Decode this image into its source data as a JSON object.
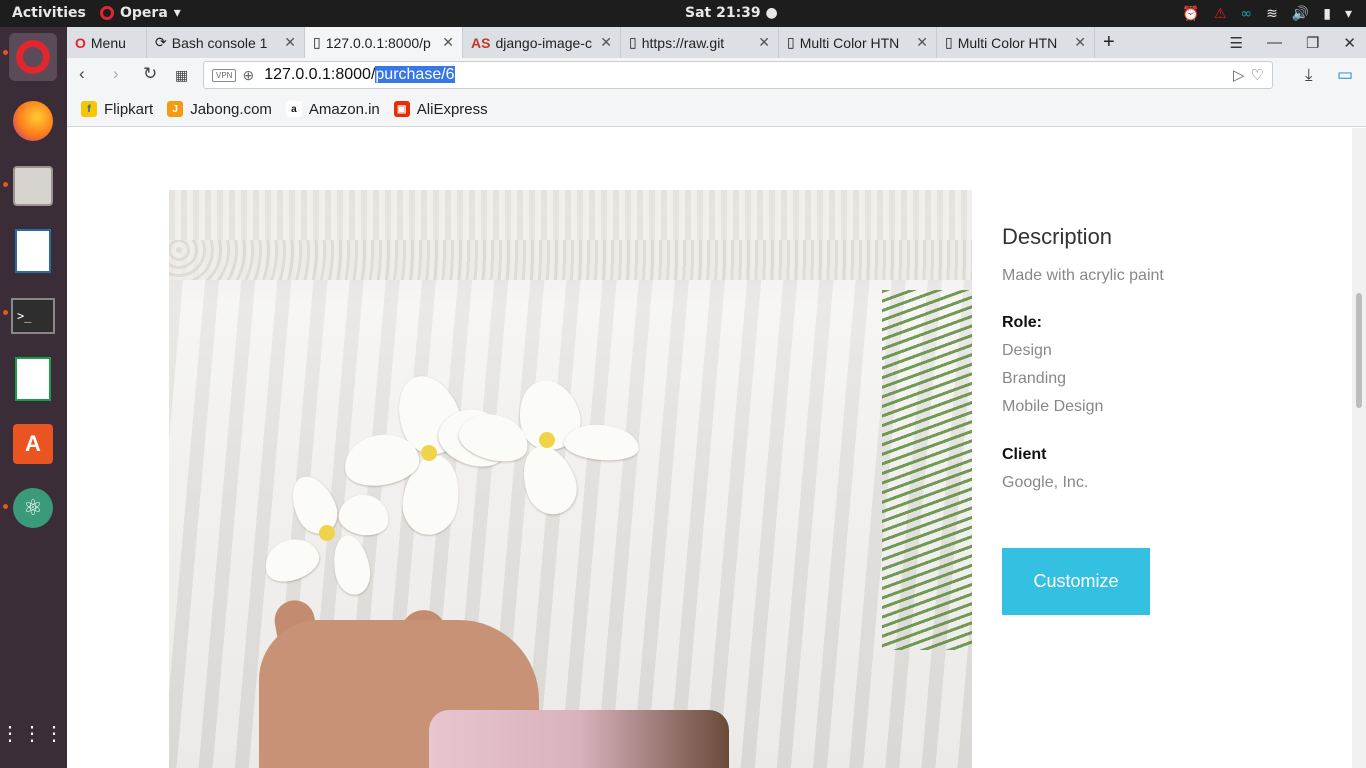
{
  "topbar": {
    "activities": "Activities",
    "app_name": "Opera",
    "clock": "Sat 21:39 ●"
  },
  "dock": {
    "icons": [
      "opera-browser",
      "firefox",
      "file-manager",
      "libreoffice-writer",
      "terminal",
      "libreoffice-calc",
      "software-center",
      "atom-editor",
      "show-applications"
    ]
  },
  "browser": {
    "menu_label": "Menu",
    "tabs": [
      {
        "label": "Bash console 1"
      },
      {
        "label": "127.0.0.1:8000/p"
      },
      {
        "label": "django-image-c"
      },
      {
        "label": "https://raw.git"
      },
      {
        "label": "Multi Color HTN"
      },
      {
        "label": "Multi Color HTN"
      }
    ],
    "vpn_label": "VPN",
    "url_base": "127.0.0.1:8000/",
    "url_selected": "purchase/6",
    "bookmarks": [
      {
        "label": "Flipkart",
        "color": "#f7c600"
      },
      {
        "label": "Jabong.com",
        "color": "#f39c12"
      },
      {
        "label": "Amazon.in",
        "color": "#ffffff"
      },
      {
        "label": "AliExpress",
        "color": "#e62e04"
      }
    ]
  },
  "details": {
    "description_title": "Description",
    "description_text": "Made with acrylic paint",
    "role_label": "Role:",
    "roles": [
      "Design",
      "Branding",
      "Mobile Design"
    ],
    "client_label": "Client",
    "client_value": "Google, Inc.",
    "customize_button": "Customize"
  },
  "colors": {
    "accent": "#34c0e0",
    "selection": "#3877e6",
    "dock_bg": "#3a2d38",
    "topbar_bg": "#1d1d1d"
  }
}
